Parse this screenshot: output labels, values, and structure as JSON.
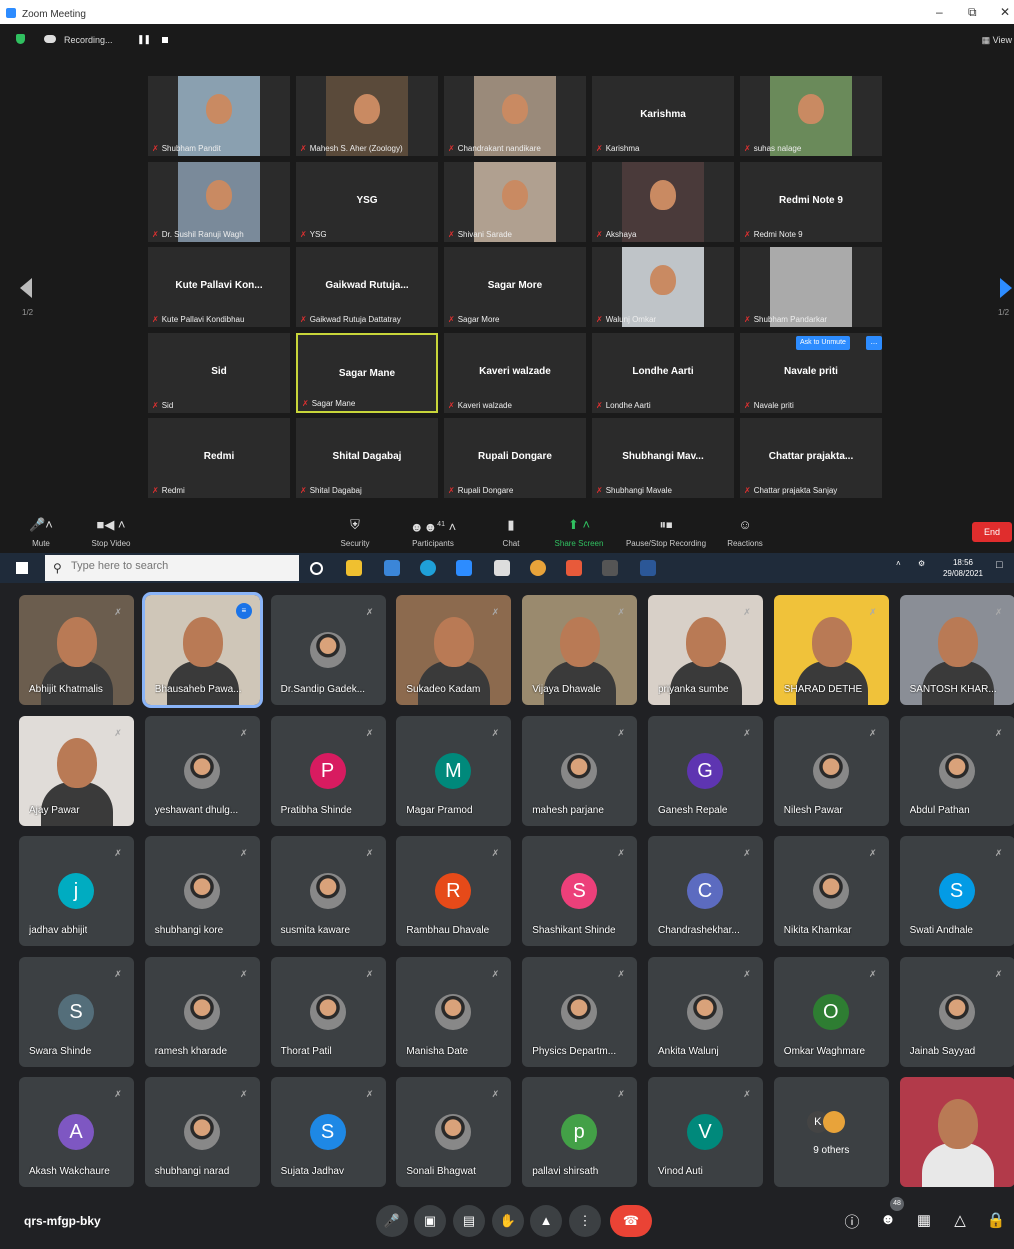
{
  "zoom": {
    "title": "Zoom Meeting",
    "recording_label": "Recording...",
    "view_label": "View",
    "page_indicator": "1/2",
    "unmute_label": "Ask to Unmute",
    "more_label": "...",
    "tiles": [
      {
        "big": "",
        "small": "Shubham Pandit"
      },
      {
        "big": "",
        "small": "Mahesh S. Aher (Zoology)"
      },
      {
        "big": "",
        "small": "Chandrakant nandikare"
      },
      {
        "big": "Karishma",
        "small": "Karishma"
      },
      {
        "big": "",
        "small": "suhas nalage"
      },
      {
        "big": "",
        "small": "Dr. Sushil Ranuji Wagh"
      },
      {
        "big": "YSG",
        "small": "YSG"
      },
      {
        "big": "",
        "small": "Shivani Sarade"
      },
      {
        "big": "",
        "small": "Akshaya"
      },
      {
        "big": "Redmi Note 9",
        "small": "Redmi Note 9"
      },
      {
        "big": "Kute Pallavi Kon...",
        "small": "Kute Pallavi Kondibhau"
      },
      {
        "big": "Gaikwad Rutuja...",
        "small": "Gaikwad Rutuja Dattatray"
      },
      {
        "big": "Sagar More",
        "small": "Sagar More"
      },
      {
        "big": "",
        "small": "Walunj Omkar"
      },
      {
        "big": "",
        "small": "Shubham Pandarkar"
      },
      {
        "big": "Sid",
        "small": "Sid"
      },
      {
        "big": "Sagar Mane",
        "small": "Sagar Mane"
      },
      {
        "big": "Kaveri walzade",
        "small": "Kaveri walzade"
      },
      {
        "big": "Londhe Aarti",
        "small": "Londhe Aarti"
      },
      {
        "big": "Navale priti",
        "small": "Navale priti"
      },
      {
        "big": "Redmi",
        "small": "Redmi"
      },
      {
        "big": "Shital Dagabaj",
        "small": "Shital Dagabaj"
      },
      {
        "big": "Rupali Dongare",
        "small": "Rupali Dongare"
      },
      {
        "big": "Shubhangi Mav...",
        "small": "Shubhangi Mavale"
      },
      {
        "big": "Chattar prajakta...",
        "small": "Chattar prajakta Sanjay"
      }
    ],
    "toolbar": {
      "mute": "Mute",
      "stop_video": "Stop Video",
      "security": "Security",
      "participants": "Participants",
      "participants_count": "41",
      "chat": "Chat",
      "share": "Share Screen",
      "record": "Pause/Stop Recording",
      "reactions": "Reactions",
      "end": "End"
    }
  },
  "taskbar": {
    "search_placeholder": "Type here to search",
    "time": "18:56",
    "date": "29/08/2021"
  },
  "meet": {
    "code": "qrs-mfgp-bky",
    "people_count": "48",
    "others_initial": "K",
    "tiles": [
      {
        "name": "Abhijit Khatmalis",
        "kind": "video"
      },
      {
        "name": "Bhausaheb Pawa...",
        "kind": "video"
      },
      {
        "name": "Dr.Sandip Gadek...",
        "kind": "photo"
      },
      {
        "name": "Sukadeo Kadam",
        "kind": "video"
      },
      {
        "name": "Vijaya Dhawale",
        "kind": "video"
      },
      {
        "name": "priyanka sumbe",
        "kind": "video"
      },
      {
        "name": "SHARAD DETHE",
        "kind": "video"
      },
      {
        "name": "SANTOSH KHAR...",
        "kind": "video"
      },
      {
        "name": "Ajay Pawar",
        "kind": "video"
      },
      {
        "name": "yeshawant dhulg...",
        "kind": "photo"
      },
      {
        "name": "Pratibha Shinde",
        "kind": "letter",
        "letter": "P",
        "color": "#d81b60"
      },
      {
        "name": "Magar Pramod",
        "kind": "letter",
        "letter": "M",
        "color": "#00897b"
      },
      {
        "name": "mahesh parjane",
        "kind": "photo"
      },
      {
        "name": "Ganesh Repale",
        "kind": "letter",
        "letter": "G",
        "color": "#5e35b1"
      },
      {
        "name": "Nilesh Pawar",
        "kind": "photo"
      },
      {
        "name": "Abdul Pathan",
        "kind": "photo"
      },
      {
        "name": "jadhav abhijit",
        "kind": "letter",
        "letter": "j",
        "color": "#00acc1"
      },
      {
        "name": "shubhangi kore",
        "kind": "photo"
      },
      {
        "name": "susmita kaware",
        "kind": "photo"
      },
      {
        "name": "Rambhau Dhavale",
        "kind": "letter",
        "letter": "R",
        "color": "#e64a19"
      },
      {
        "name": "Shashikant Shinde",
        "kind": "letter",
        "letter": "S",
        "color": "#ec407a"
      },
      {
        "name": "Chandrashekhar...",
        "kind": "letter",
        "letter": "C",
        "color": "#5c6bc0"
      },
      {
        "name": "Nikita Khamkar",
        "kind": "photo"
      },
      {
        "name": "Swati Andhale",
        "kind": "letter",
        "letter": "S",
        "color": "#039be5"
      },
      {
        "name": "Swara Shinde",
        "kind": "letter",
        "letter": "S",
        "color": "#546e7a"
      },
      {
        "name": "ramesh kharade",
        "kind": "photo"
      },
      {
        "name": "Thorat Patil",
        "kind": "photo"
      },
      {
        "name": "Manisha Date",
        "kind": "photo"
      },
      {
        "name": "Physics Departm...",
        "kind": "photo"
      },
      {
        "name": "Ankita Walunj",
        "kind": "photo"
      },
      {
        "name": "Omkar Waghmare",
        "kind": "letter",
        "letter": "O",
        "color": "#2e7d32"
      },
      {
        "name": "Jainab Sayyad",
        "kind": "photo"
      },
      {
        "name": "Akash Wakchaure",
        "kind": "letter",
        "letter": "A",
        "color": "#7e57c2"
      },
      {
        "name": "shubhangi narad",
        "kind": "photo"
      },
      {
        "name": "Sujata Jadhav",
        "kind": "letter",
        "letter": "S",
        "color": "#1e88e5"
      },
      {
        "name": "Sonali Bhagwat",
        "kind": "photo"
      },
      {
        "name": "pallavi shirsath",
        "kind": "letter",
        "letter": "p",
        "color": "#43a047"
      },
      {
        "name": "Vinod Auti",
        "kind": "letter",
        "letter": "V",
        "color": "#00897b"
      },
      {
        "name": "9 others",
        "kind": "others"
      },
      {
        "name": "",
        "kind": "self"
      }
    ]
  }
}
